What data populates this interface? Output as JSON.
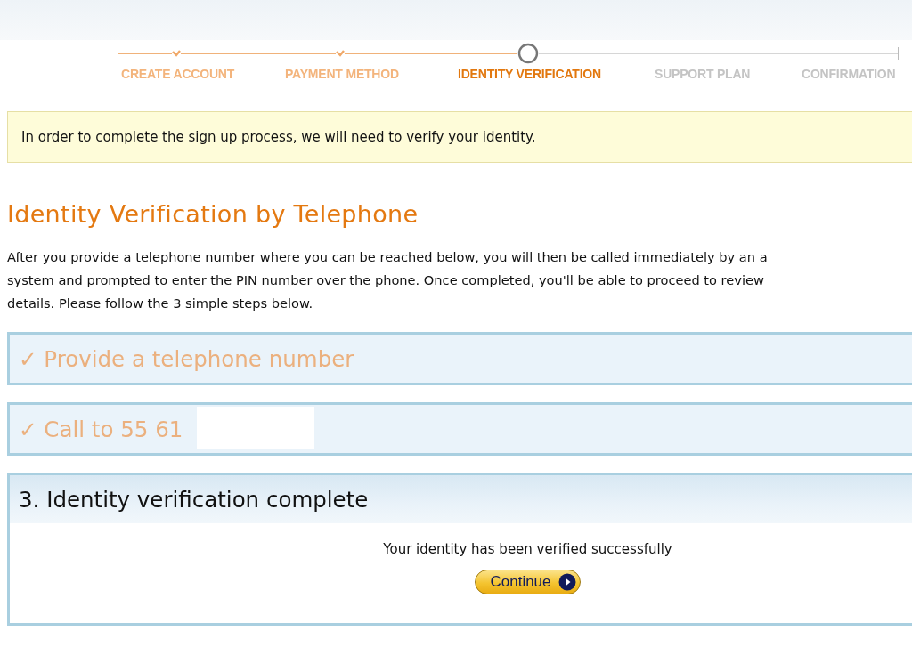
{
  "progress": {
    "steps": [
      {
        "label": "CREATE ACCOUNT",
        "done": true,
        "current": false
      },
      {
        "label": "PAYMENT METHOD",
        "done": true,
        "current": false
      },
      {
        "label": "IDENTITY VERIFICATION",
        "done": false,
        "current": true
      },
      {
        "label": "SUPPORT PLAN",
        "done": false,
        "current": false
      },
      {
        "label": "CONFIRMATION",
        "done": false,
        "current": false
      }
    ]
  },
  "notice": "In order to complete the sign up process, we will need to verify your identity.",
  "heading": "Identity Verification by Telephone",
  "intro_lines": [
    "After you provide a telephone number where you can be reached below, you will then be called immediately by an a",
    "system and prompted to enter the PIN number over the phone. Once completed, you'll be able to proceed to review",
    "details. Please follow the 3 simple steps below."
  ],
  "panels": [
    {
      "title": "✓ Provide a telephone number",
      "expanded": false,
      "redacted": false
    },
    {
      "title": "✓ Call to 55 61",
      "expanded": false,
      "redacted": true
    },
    {
      "title": "3. Identity verification complete",
      "expanded": true,
      "redacted": false,
      "message": "Your identity has been verified successfully",
      "button": "Continue"
    }
  ]
}
